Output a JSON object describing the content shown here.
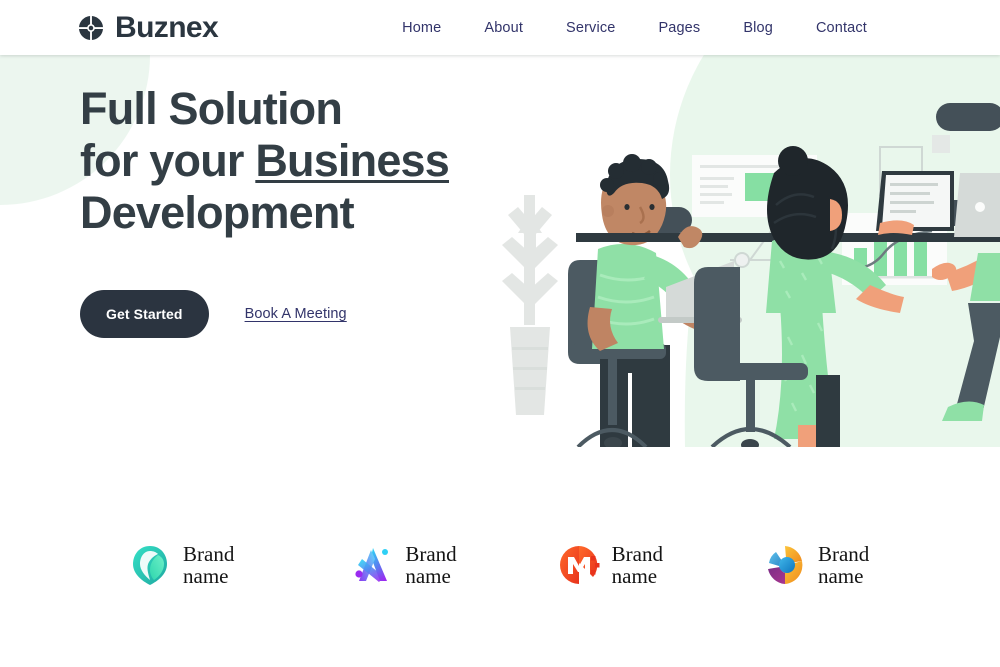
{
  "header": {
    "logo": {
      "icon": "buznex-quadrant-circle-icon",
      "text": "Buznex"
    },
    "nav": [
      {
        "label": "Home"
      },
      {
        "label": "About"
      },
      {
        "label": "Service"
      },
      {
        "label": "Pages"
      },
      {
        "label": "Blog"
      },
      {
        "label": "Contact"
      }
    ]
  },
  "hero": {
    "title_line1": "Full Solution",
    "title_line2_pre": "for your ",
    "title_line2_underlined": "Business",
    "title_line3": "Development",
    "primary_button": "Get Started",
    "secondary_link": "Book A Meeting",
    "illustration": "office-team-working-illustration"
  },
  "brands": [
    {
      "icon": "leaf-drop-logo-icon",
      "name": "Brand\nname"
    },
    {
      "icon": "letter-a-gradient-logo-icon",
      "name": "Brand\nname"
    },
    {
      "icon": "letter-m-circle-logo-icon",
      "name": "Brand\nname"
    },
    {
      "icon": "color-swirl-circle-logo-icon",
      "name": "Brand\nname"
    }
  ],
  "colors": {
    "text_dark": "#333e45",
    "nav_navy": "#32346a",
    "button_dark": "#2b3440",
    "accent_green": "#86dfa3",
    "hero_blob": "#e9f5ec",
    "illustration_bg": "#e6f6ea"
  }
}
